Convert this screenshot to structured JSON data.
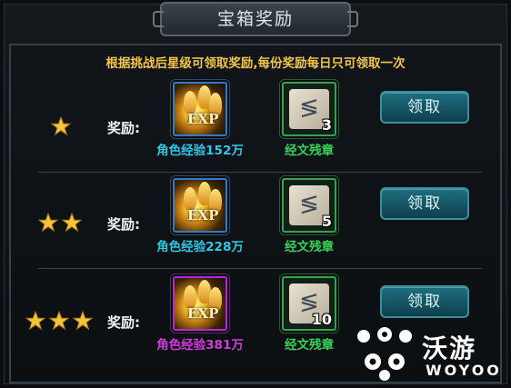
{
  "title": "宝箱奖励",
  "hint": "根据挑战后星级可领取奖励,每份奖励每日只可领取一次",
  "rows": [
    {
      "stars": 1,
      "reward_label": "奖励:",
      "exp_item": {
        "icon": "exp-icon",
        "icon_text": "EXP",
        "caption": "角色经验152万",
        "rarity_color": "#2ec8e6"
      },
      "fragment_item": {
        "icon": "scroll-fragment-icon",
        "count": "3",
        "caption": "经文残章"
      },
      "claim_label": "领取"
    },
    {
      "stars": 2,
      "reward_label": "奖励:",
      "exp_item": {
        "icon": "exp-icon",
        "icon_text": "EXP",
        "caption": "角色经验228万",
        "rarity_color": "#2ec8e6"
      },
      "fragment_item": {
        "icon": "scroll-fragment-icon",
        "count": "5",
        "caption": "经文残章"
      },
      "claim_label": "领取"
    },
    {
      "stars": 3,
      "reward_label": "奖励:",
      "exp_item": {
        "icon": "exp-icon",
        "icon_text": "EXP",
        "caption": "角色经验381万",
        "rarity_color": "#d63adf"
      },
      "fragment_item": {
        "icon": "scroll-fragment-icon",
        "count": "10",
        "caption": "经文残章"
      },
      "claim_label": "领取"
    }
  ],
  "watermark": {
    "name_cn": "沃游",
    "name_en": "WOYOO"
  },
  "colors": {
    "hint": "#f3c64a",
    "claim_button": "#1e6f80",
    "star": "#f5c43a"
  }
}
